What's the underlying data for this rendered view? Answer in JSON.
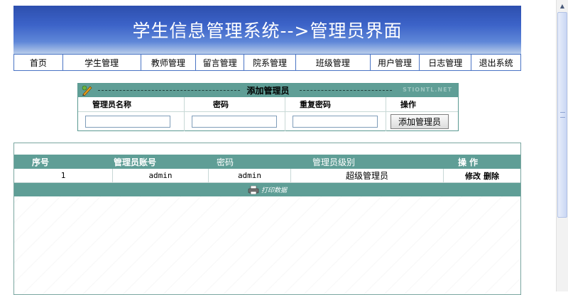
{
  "banner": {
    "title": "学生信息管理系统-->管理员界面"
  },
  "nav": {
    "items": [
      {
        "label": "首页"
      },
      {
        "label": "学生管理"
      },
      {
        "label": "教师管理"
      },
      {
        "label": "留言管理"
      },
      {
        "label": "院系管理"
      },
      {
        "label": "班级管理"
      },
      {
        "label": "用户管理"
      },
      {
        "label": "日志管理"
      },
      {
        "label": "退出系统"
      }
    ]
  },
  "add_panel": {
    "title": "添加管理员",
    "watermark": "STIONTL.NET",
    "columns": [
      "管理员名称",
      "密码",
      "重复密码",
      "操作"
    ],
    "inputs": {
      "name": "",
      "password": "",
      "repeat_password": ""
    },
    "submit_label": "添加管理员"
  },
  "list": {
    "columns": [
      "序号",
      "管理员账号",
      "密码",
      "管理员级别",
      "操 作"
    ],
    "rows": [
      {
        "index": "1",
        "account": "admin",
        "password": "admin",
        "level": "超级管理员",
        "edit": "修改",
        "delete": "删除"
      }
    ],
    "print_label": "打印数据"
  },
  "colors": {
    "banner": "#3c63c8",
    "teal_header": "#5f9e96",
    "nav_border": "#4a74c4"
  },
  "icons": [
    "pencil-icon",
    "printer-icon",
    "scroll-up-icon"
  ]
}
